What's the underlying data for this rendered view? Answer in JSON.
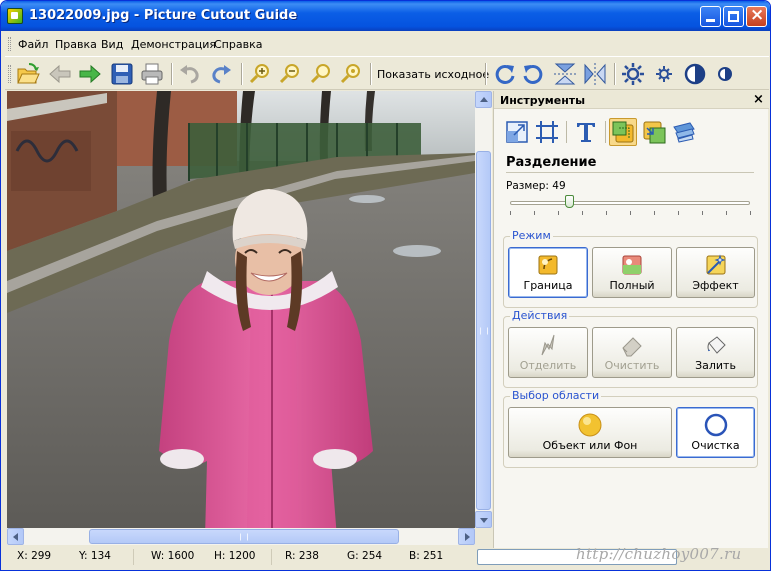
{
  "window": {
    "title": "13022009.jpg - Picture Cutout Guide",
    "accent_color": "#0b5ee6",
    "controls": [
      "minimize-icon",
      "maximize-icon",
      "close-icon"
    ]
  },
  "menu": {
    "items": [
      "Файл",
      "Правка",
      "Вид",
      "Демонстрация",
      "Справка"
    ]
  },
  "toolbar": {
    "buttons": [
      "open-icon",
      "back-icon",
      "forward-icon",
      "save-icon",
      "print-icon",
      "undo-icon",
      "redo-icon",
      "zoom-in-icon",
      "zoom-out-icon",
      "zoom-fit-icon",
      "zoom-actual-icon"
    ],
    "show_original_label": "Показать исходное",
    "after_buttons": [
      "rotate-cw-icon",
      "rotate-ccw-icon",
      "flip-vertical-icon",
      "flip-horizontal-icon",
      "brightness-up-icon",
      "brightness-down-icon",
      "contrast-up-icon",
      "contrast-down-icon"
    ]
  },
  "canvas": {
    "image_description_icon": "photo-canvas"
  },
  "panel": {
    "title": "Инструменты",
    "close": "×",
    "tools": [
      "resize-icon",
      "crop-icon",
      "text-icon",
      "cutout-icon",
      "replace-background-icon",
      "effect-tool-icon"
    ],
    "active_tool": "cutout-icon",
    "section_title": "Разделение",
    "size_label": "Размер: 49",
    "size_value": 49,
    "size_max": 200,
    "mode": {
      "label": "Режим",
      "buttons": [
        {
          "label": "Граница",
          "icon": "border-mode-icon",
          "selected": true
        },
        {
          "label": "Полный",
          "icon": "full-mode-icon",
          "selected": false
        },
        {
          "label": "Эффект",
          "icon": "effect-mode-icon",
          "selected": false
        }
      ]
    },
    "actions": {
      "label": "Действия",
      "buttons": [
        {
          "label": "Отделить",
          "icon": "separate-icon",
          "disabled": true
        },
        {
          "label": "Очистить",
          "icon": "eraser-icon",
          "disabled": true
        },
        {
          "label": "Залить",
          "icon": "fill-bucket-icon",
          "disabled": false
        }
      ]
    },
    "area": {
      "label": "Выбор области",
      "buttons": [
        {
          "label": "Объект или Фон",
          "icon": "object-or-background-icon",
          "color": "#f2c230"
        },
        {
          "label": "Очистка",
          "icon": "clear-area-icon",
          "color": "#2a54b8",
          "selected": true
        }
      ]
    }
  },
  "status": {
    "x": "X: 299",
    "y": "Y: 134",
    "w": "W: 1600",
    "h": "H: 1200",
    "r": "R: 238",
    "g": "G: 254",
    "b": "B: 251"
  },
  "watermark": "http://chuzhoy007.ru"
}
